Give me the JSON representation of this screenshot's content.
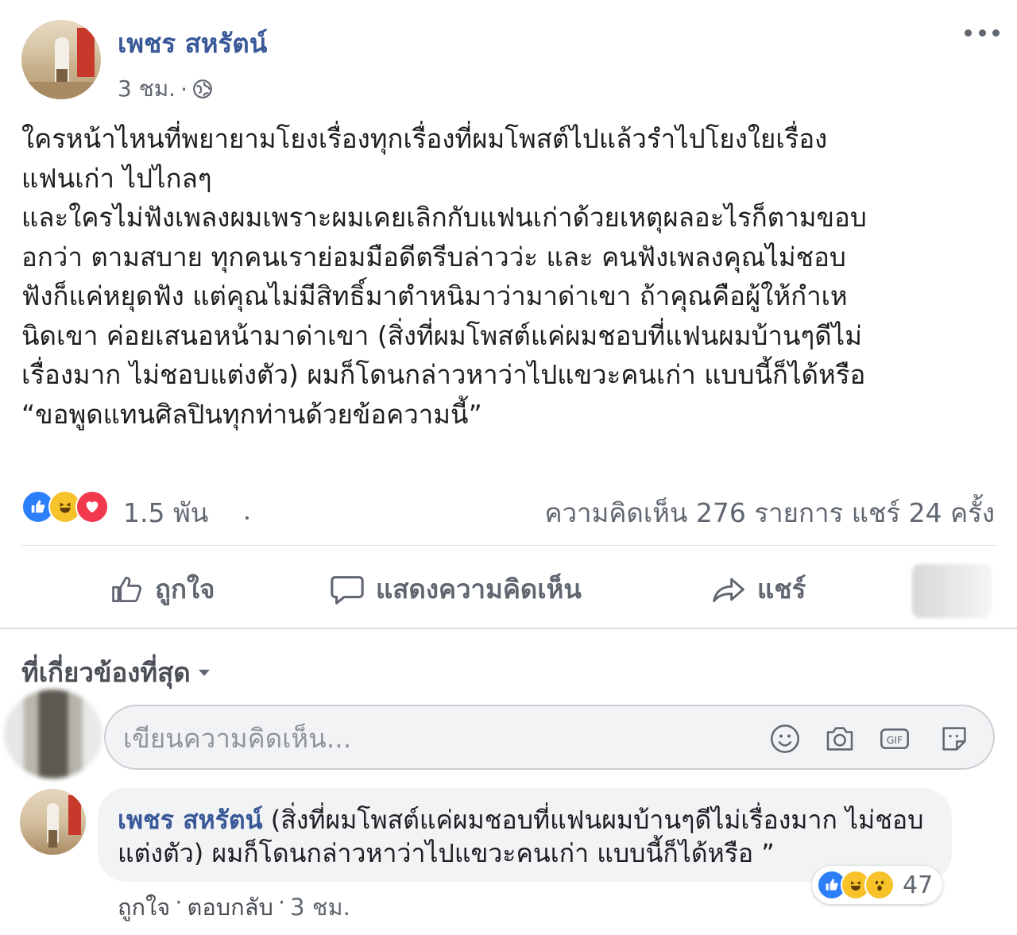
{
  "post": {
    "author": "เพชร สหรัตน์",
    "time": "3 ชม.",
    "separator": "·",
    "privacy_icon": "globe-icon",
    "text": "ใครหน้าไหนที่พยายามโยงเรื่องทุกเรื่องที่ผมโพสต์ไปแล้วรำไปโยงใยเรื่อง\nแฟนเก่า ไปไกลๆ\nและใครไม่ฟังเพลงผมเพราะผมเคยเลิกกับแฟนเก่าด้วยเหตุผลอะไรก็ตามขอบ\nอกว่า ตามสบาย ทุกคนเราย่อมมือดีตรีบล่าวว่ะ และ คนฟังเพลงคุณไม่ชอบ\nฟังก็แค่หยุดฟัง แต่คุณไม่มีสิทธิ์มาตำหนิมาว่ามาด่าเขา ถ้าคุณคือผู้ให้กำเห\nนิดเขา ค่อยเสนอหน้ามาด่าเขา (สิ่งที่ผมโพสต์แค่ผมชอบที่แฟนผมบ้านๆดีไม่\nเรื่องมาก ไม่ชอบแต่งตัว) ผมก็โดนกล่าวหาว่าไปแขวะคนเก่า แบบนี้ก็ได้หรือ\n“ขอพูดแทนศิลปินทุกท่านด้วยข้อความนี้”"
  },
  "summary": {
    "reaction_icons": [
      "like-icon",
      "haha-icon",
      "love-icon"
    ],
    "reaction_count": "1.5 พัน",
    "comments_shares": "ความคิดเห็น 276 รายการ แชร์ 24 ครั้ง"
  },
  "actions": {
    "like": "ถูกใจ",
    "comment": "แสดงความคิดเห็น",
    "share": "แชร์"
  },
  "comments_section": {
    "sort_label": "ที่เกี่ยวข้องที่สุด",
    "composer_placeholder": "เขียนความคิดเห็น...",
    "composer_icons": [
      "emoji-icon",
      "camera-icon",
      "gif-icon",
      "sticker-icon"
    ]
  },
  "comment": {
    "author": "เพชร สหรัตน์",
    "text": " (สิ่งที่ผมโพสต์แค่ผมชอบที่แฟนผมบ้านๆดีไม่เรื่องมาก ไม่ชอบแต่งตัว) ผมก็โดนกล่าวหาว่าไปแขวะคนเก่า แบบนี้ก็ได้หรือ ”",
    "reaction_icons": [
      "like-icon",
      "haha-icon",
      "wow-icon"
    ],
    "reaction_count": "47",
    "like_link": "ถูกใจ",
    "reply_link": "ตอบกลับ",
    "time": "3 ชม.",
    "separator": "·"
  },
  "colors": {
    "link_blue": "#385898",
    "like_blue": "#2d7ff9",
    "haha_yellow": "#f7c22a",
    "love_red": "#f0394d",
    "secondary_text": "#606770"
  }
}
